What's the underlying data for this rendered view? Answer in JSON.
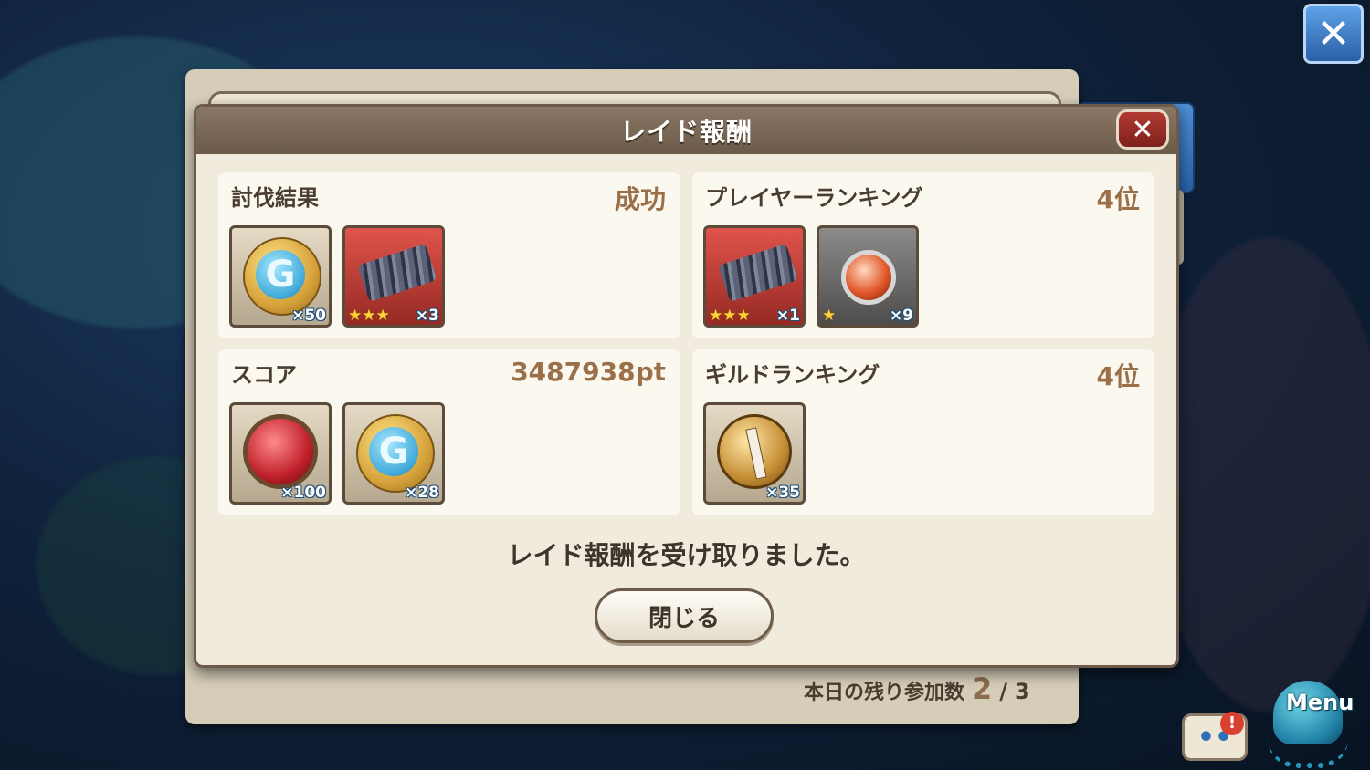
{
  "dialog": {
    "title": "レイド報酬",
    "close_label": "✕",
    "message": "レイド報酬を受け取りました。",
    "close_button_label": "閉じる"
  },
  "sections": {
    "result": {
      "title": "討伐結果",
      "value": "成功",
      "items": [
        {
          "icon": "g-coin-icon",
          "qty": "×50",
          "stars": ""
        },
        {
          "icon": "wrap-material-icon",
          "qty": "×3",
          "stars": "★★★"
        }
      ]
    },
    "player_ranking": {
      "title": "プレイヤーランキング",
      "value": "4位",
      "items": [
        {
          "icon": "wrap-material-icon",
          "qty": "×1",
          "stars": "★★★"
        },
        {
          "icon": "fire-gem-icon",
          "qty": "×9",
          "stars": "★"
        }
      ]
    },
    "score": {
      "title": "スコア",
      "value": "3487938pt",
      "items": [
        {
          "icon": "ruby-icon",
          "qty": "×100",
          "stars": ""
        },
        {
          "icon": "g-coin-icon",
          "qty": "×28",
          "stars": ""
        }
      ]
    },
    "guild_ranking": {
      "title": "ギルドランキング",
      "value": "4位",
      "items": [
        {
          "icon": "guild-medal-icon",
          "qty": "×35",
          "stars": ""
        }
      ]
    }
  },
  "back_panel": {
    "remaining_label": "本日の残り参加数",
    "remaining_value": "2",
    "separator": "/",
    "remaining_max": "3"
  },
  "hud": {
    "top_close_label": "✕",
    "chat_label": "••",
    "chat_alert": "!",
    "menu_label": "Menu"
  },
  "colors": {
    "dialog_header": "#7a6856",
    "value_text": "#9b7048",
    "close_button": "#a1332c",
    "top_close_button": "#3d7fc9"
  }
}
